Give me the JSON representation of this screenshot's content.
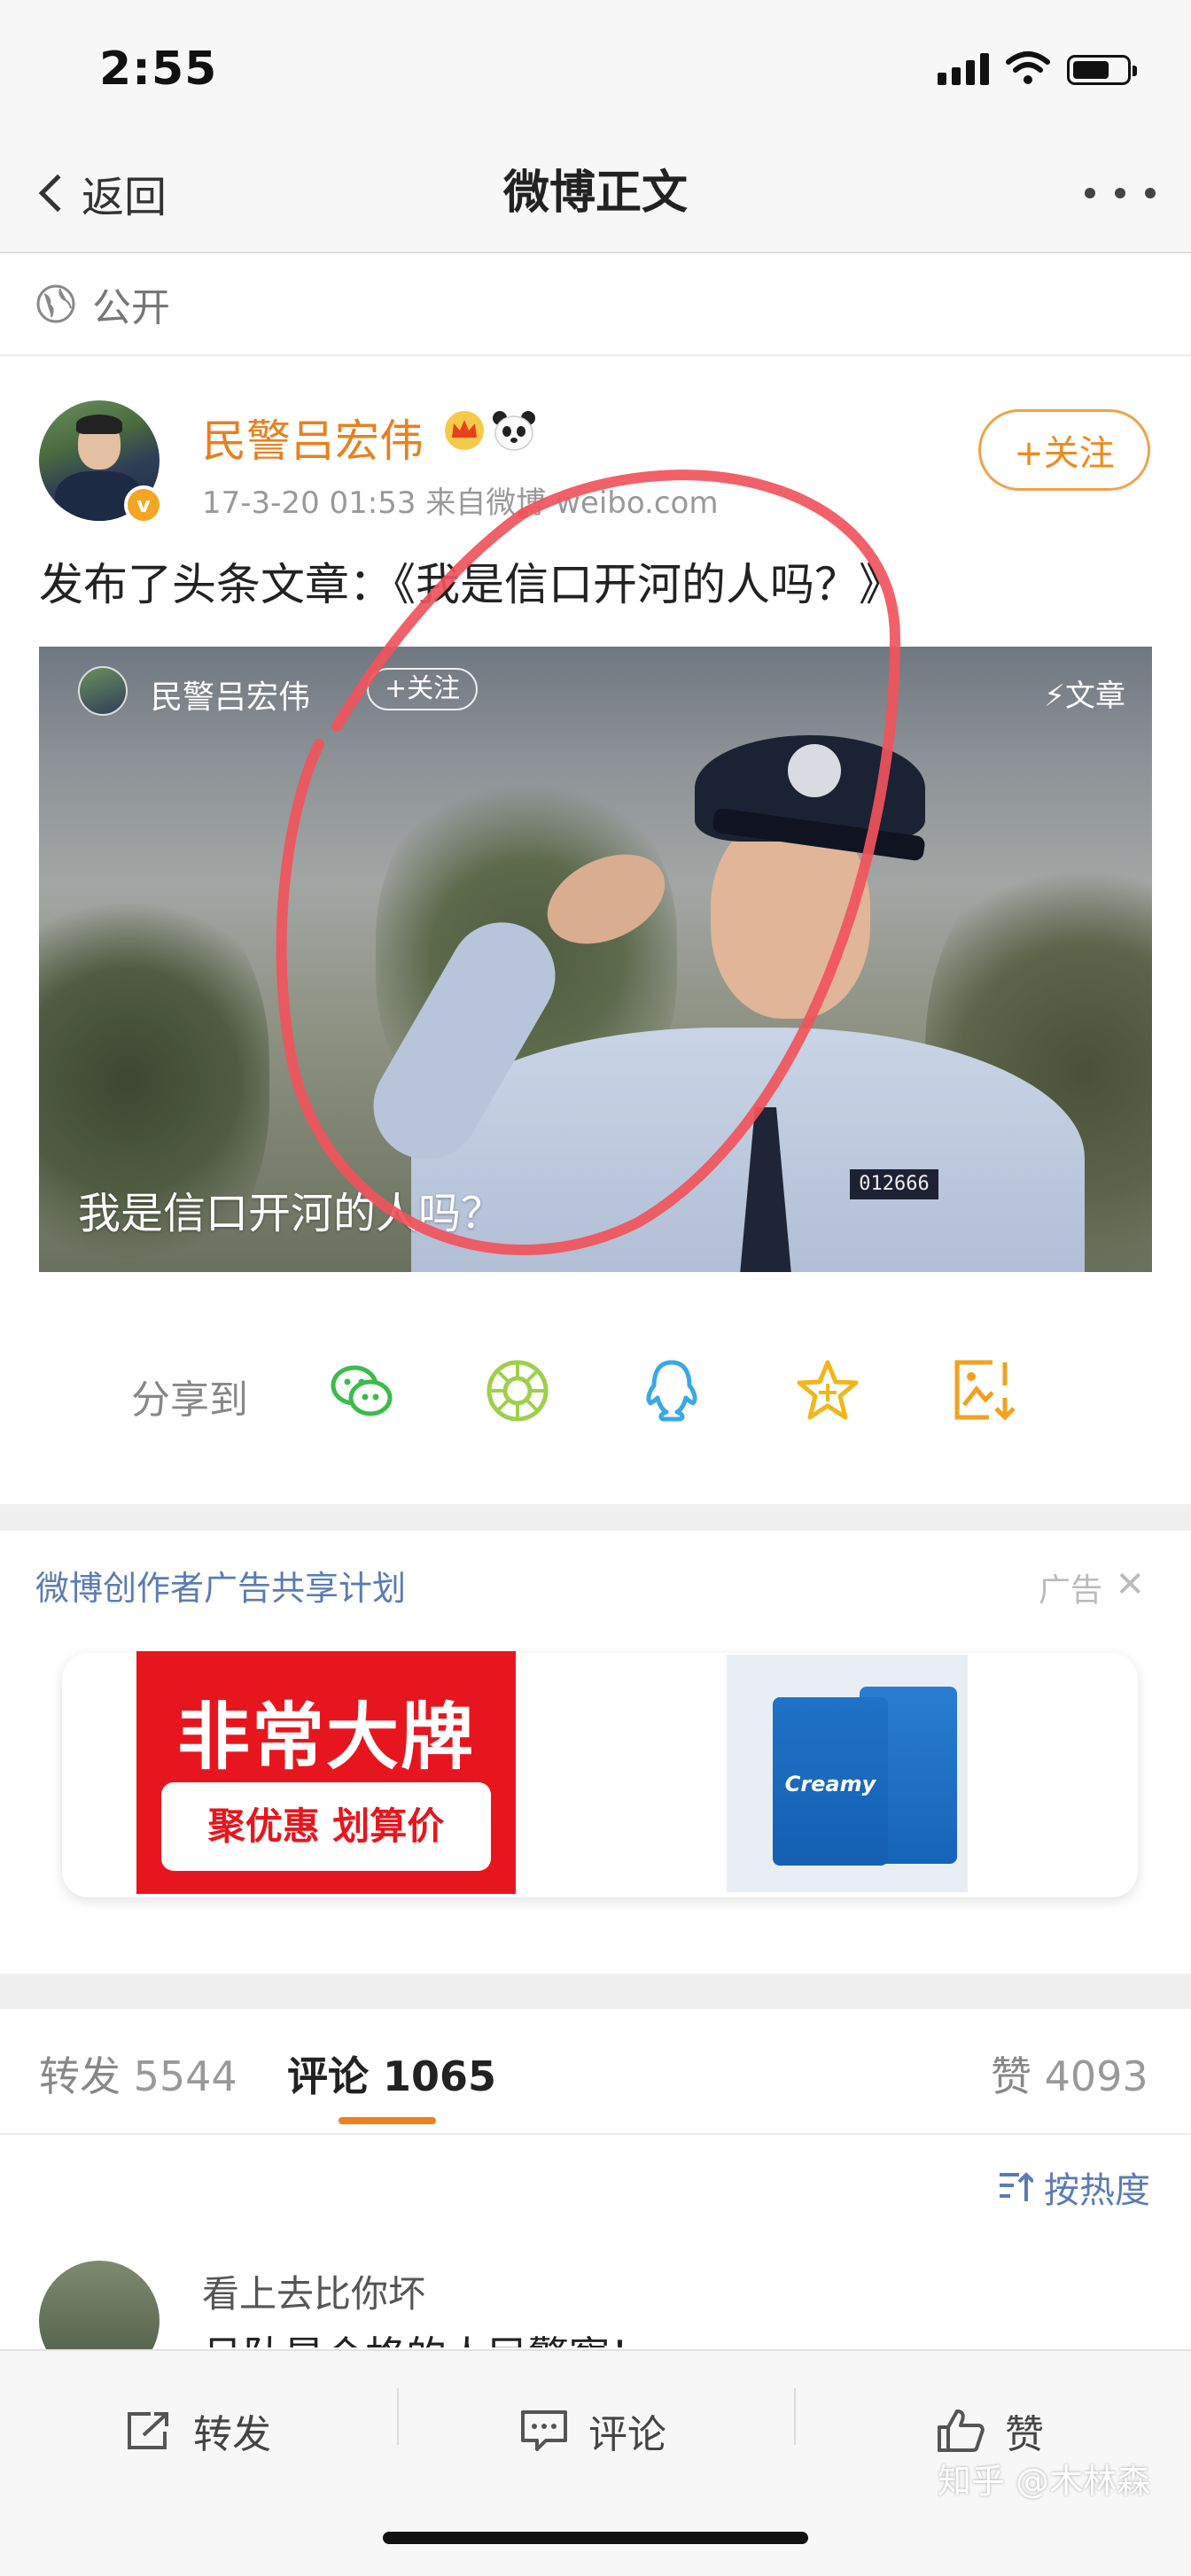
{
  "status_bar": {
    "time": "2:55"
  },
  "nav": {
    "back_label": "返回",
    "title": "微博正文"
  },
  "visibility": {
    "label": "公开"
  },
  "post": {
    "author": "民警吕宏伟",
    "meta": "17-3-20 01:53  来自微博 weibo.com",
    "follow_label": "+关注",
    "text": "发布了头条文章：《我是信口开河的人吗？》",
    "article": {
      "author": "民警吕宏伟",
      "follow_label": "+关注",
      "type_label": "⚡文章",
      "title": "我是信口开河的人吗？",
      "badge_number": "012666"
    }
  },
  "share": {
    "label": "分享到",
    "targets": [
      "wechat-icon",
      "moments-icon",
      "qq-icon",
      "favorite-icon",
      "save-image-icon"
    ]
  },
  "ad": {
    "program": "微博创作者广告共享计划",
    "tag": "广告",
    "brand": "非常大牌",
    "slogan": "聚优惠 划算价",
    "product": "Creamy"
  },
  "tabs": [
    {
      "label": "转发",
      "count": "5544"
    },
    {
      "label": "评论",
      "count": "1065"
    },
    {
      "label": "赞",
      "count": "4093"
    }
  ],
  "sort": {
    "label": "按热度"
  },
  "comment": {
    "author": "看上去比你坏",
    "text": "吕队是合格的人民警察！"
  },
  "toolbar": {
    "repost": "转发",
    "comment": "评论",
    "like": "赞"
  },
  "watermark": "知乎 @木林森",
  "colors": {
    "accent_orange": "#f08a1c",
    "link_blue": "#5a7cb5",
    "annotation_red": "#f0545c"
  }
}
